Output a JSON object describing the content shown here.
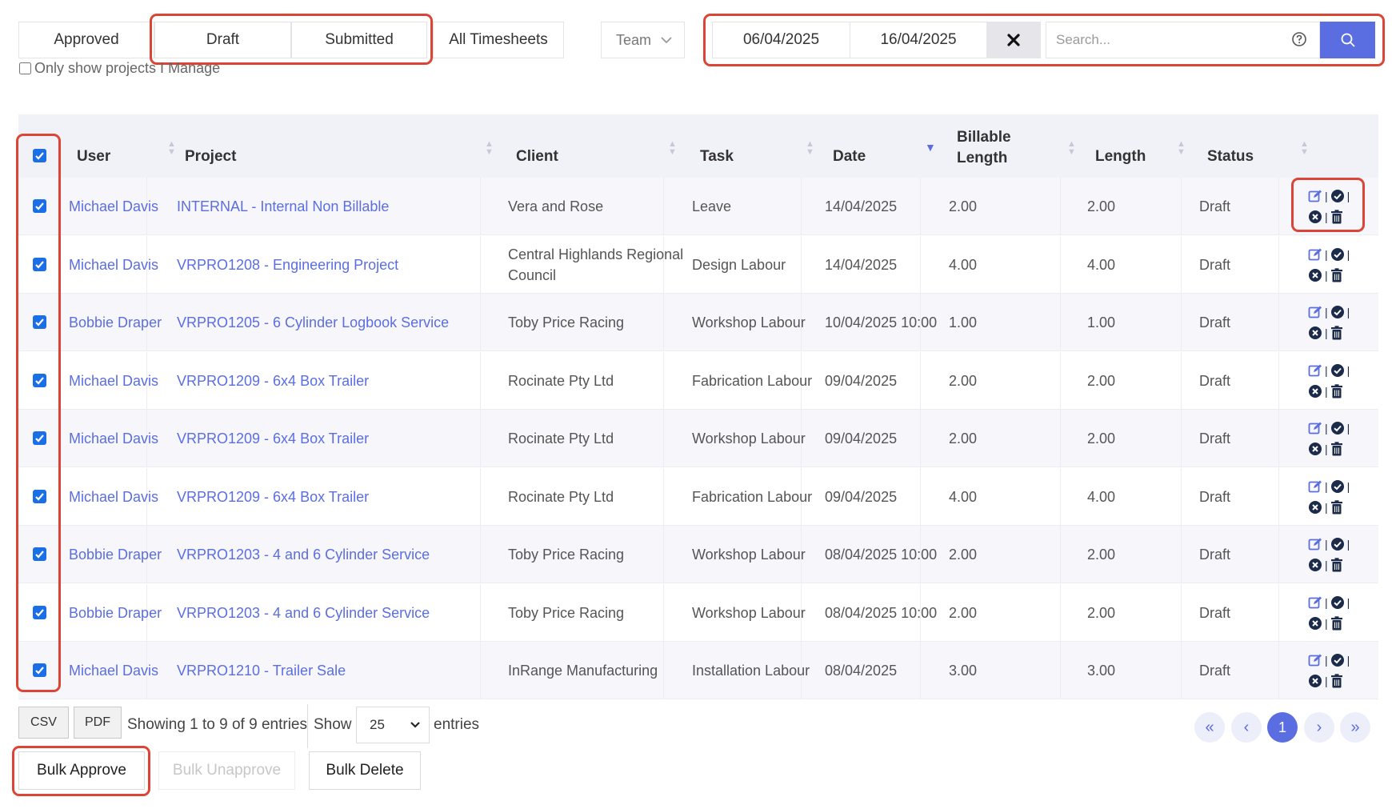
{
  "filters": {
    "tabs": [
      "Approved",
      "Draft",
      "Submitted",
      "All Timesheets"
    ],
    "team_select": "Team",
    "date_from": "06/04/2025",
    "date_to": "16/04/2025",
    "search_placeholder": "Search...",
    "only_manage_label": "Only show projects I Manage"
  },
  "table": {
    "headers": [
      "User",
      "Project",
      "Client",
      "Task",
      "Date",
      "Billable\nLength",
      "Length",
      "Status"
    ],
    "header_billable_line1": "Billable",
    "header_billable_line2": "Length",
    "rows": [
      {
        "user": "Michael Davis",
        "project": "INTERNAL - Internal Non Billable",
        "client": "Vera and Rose",
        "task": "Leave",
        "date": "14/04/2025",
        "billable": "2.00",
        "length": "2.00",
        "status": "Draft"
      },
      {
        "user": "Michael Davis",
        "project": "VRPRO1208 - Engineering Project",
        "client": "Central Highlands Regional Council",
        "task": "Design Labour",
        "date": "14/04/2025",
        "billable": "4.00",
        "length": "4.00",
        "status": "Draft"
      },
      {
        "user": "Bobbie Draper",
        "project": "VRPRO1205 - 6 Cylinder Logbook Service",
        "client": "Toby Price Racing",
        "task": "Workshop Labour",
        "date": "10/04/2025 10:00",
        "billable": "1.00",
        "length": "1.00",
        "status": "Draft"
      },
      {
        "user": "Michael Davis",
        "project": "VRPRO1209 - 6x4 Box Trailer",
        "client": "Rocinate Pty Ltd",
        "task": "Fabrication Labour",
        "date": "09/04/2025",
        "billable": "2.00",
        "length": "2.00",
        "status": "Draft"
      },
      {
        "user": "Michael Davis",
        "project": "VRPRO1209 - 6x4 Box Trailer",
        "client": "Rocinate Pty Ltd",
        "task": "Workshop Labour",
        "date": "09/04/2025",
        "billable": "2.00",
        "length": "2.00",
        "status": "Draft"
      },
      {
        "user": "Michael Davis",
        "project": "VRPRO1209 - 6x4 Box Trailer",
        "client": "Rocinate Pty Ltd",
        "task": "Fabrication Labour",
        "date": "09/04/2025",
        "billable": "4.00",
        "length": "4.00",
        "status": "Draft"
      },
      {
        "user": "Bobbie Draper",
        "project": "VRPRO1203 - 4 and 6 Cylinder Service",
        "client": "Toby Price Racing",
        "task": "Workshop Labour",
        "date": "08/04/2025 10:00",
        "billable": "2.00",
        "length": "2.00",
        "status": "Draft"
      },
      {
        "user": "Bobbie Draper",
        "project": "VRPRO1203 - 4 and 6 Cylinder Service",
        "client": "Toby Price Racing",
        "task": "Workshop Labour",
        "date": "08/04/2025 10:00",
        "billable": "2.00",
        "length": "2.00",
        "status": "Draft"
      },
      {
        "user": "Michael Davis",
        "project": "VRPRO1210 - Trailer Sale",
        "client": "InRange Manufacturing",
        "task": "Installation Labour",
        "date": "08/04/2025",
        "billable": "3.00",
        "length": "3.00",
        "status": "Draft"
      }
    ]
  },
  "footer": {
    "csv": "CSV",
    "pdf": "PDF",
    "showing": "Showing 1 to 9 of 9 entries",
    "show": "Show",
    "page_size": "25",
    "entries": "entries",
    "current_page": "1",
    "bulk_approve": "Bulk Approve",
    "bulk_unapprove": "Bulk Unapprove",
    "bulk_delete": "Bulk Delete"
  },
  "colors": {
    "accent": "#5b6ee1",
    "highlight": "#dc4536",
    "checkbox": "#1a6ee6"
  }
}
